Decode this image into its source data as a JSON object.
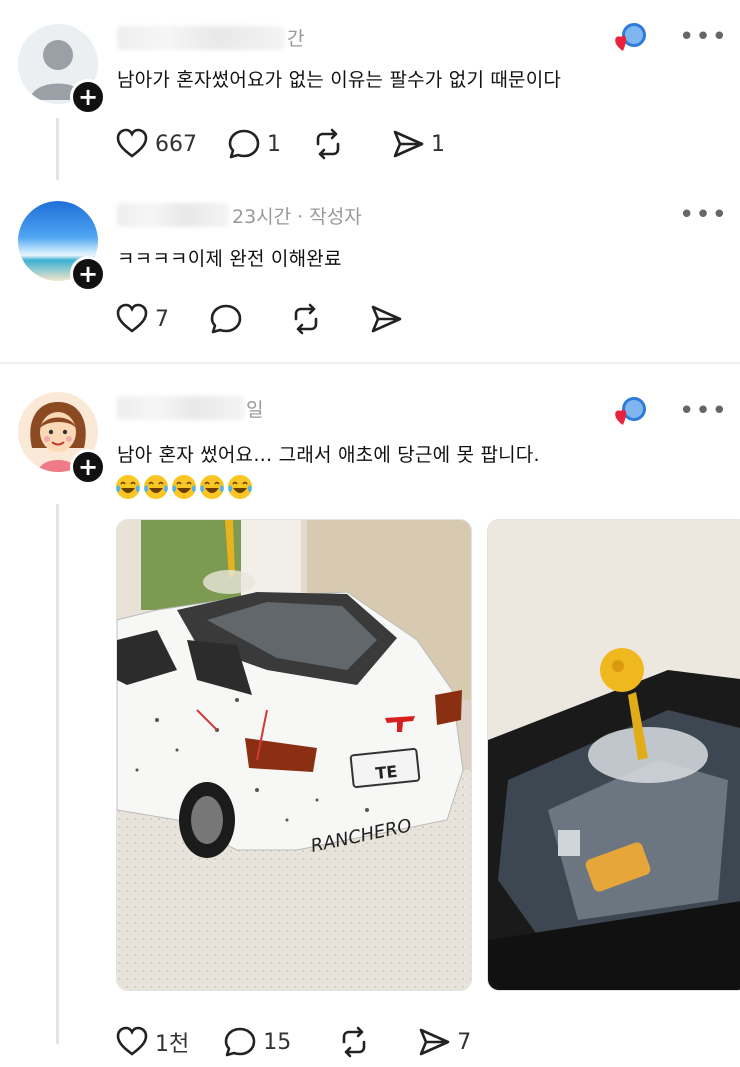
{
  "posts": [
    {
      "time": "간",
      "text": "남아가 혼자썼어요가 없는 이유는 팔수가 없기 때문이다",
      "likes": "667",
      "replies": "1",
      "reposts": "",
      "shares": "1"
    },
    {
      "time": "23시간 · 작성자",
      "text": "ㅋㅋㅋㅋ이제 완전 이해완료",
      "likes": "7",
      "replies": "",
      "reposts": "",
      "shares": ""
    },
    {
      "time": "일",
      "text": "남아 혼자 썼어요… 그래서 애초에 당근에 못 팝니다.",
      "likes": "1천",
      "replies": "15",
      "reposts": "",
      "shares": "7"
    }
  ],
  "photos": {
    "plate_text": "TE",
    "scribble_text": "RANCHERO"
  },
  "icons": {
    "like": "heart-icon",
    "reply": "comment-icon",
    "repost": "repost-icon",
    "share": "send-icon",
    "more": "more-icon"
  },
  "colors": {
    "follow_button": "#111111",
    "meta": "#999999",
    "badge_heart": "#e8233e",
    "badge_blue": "#2f7bd8"
  }
}
